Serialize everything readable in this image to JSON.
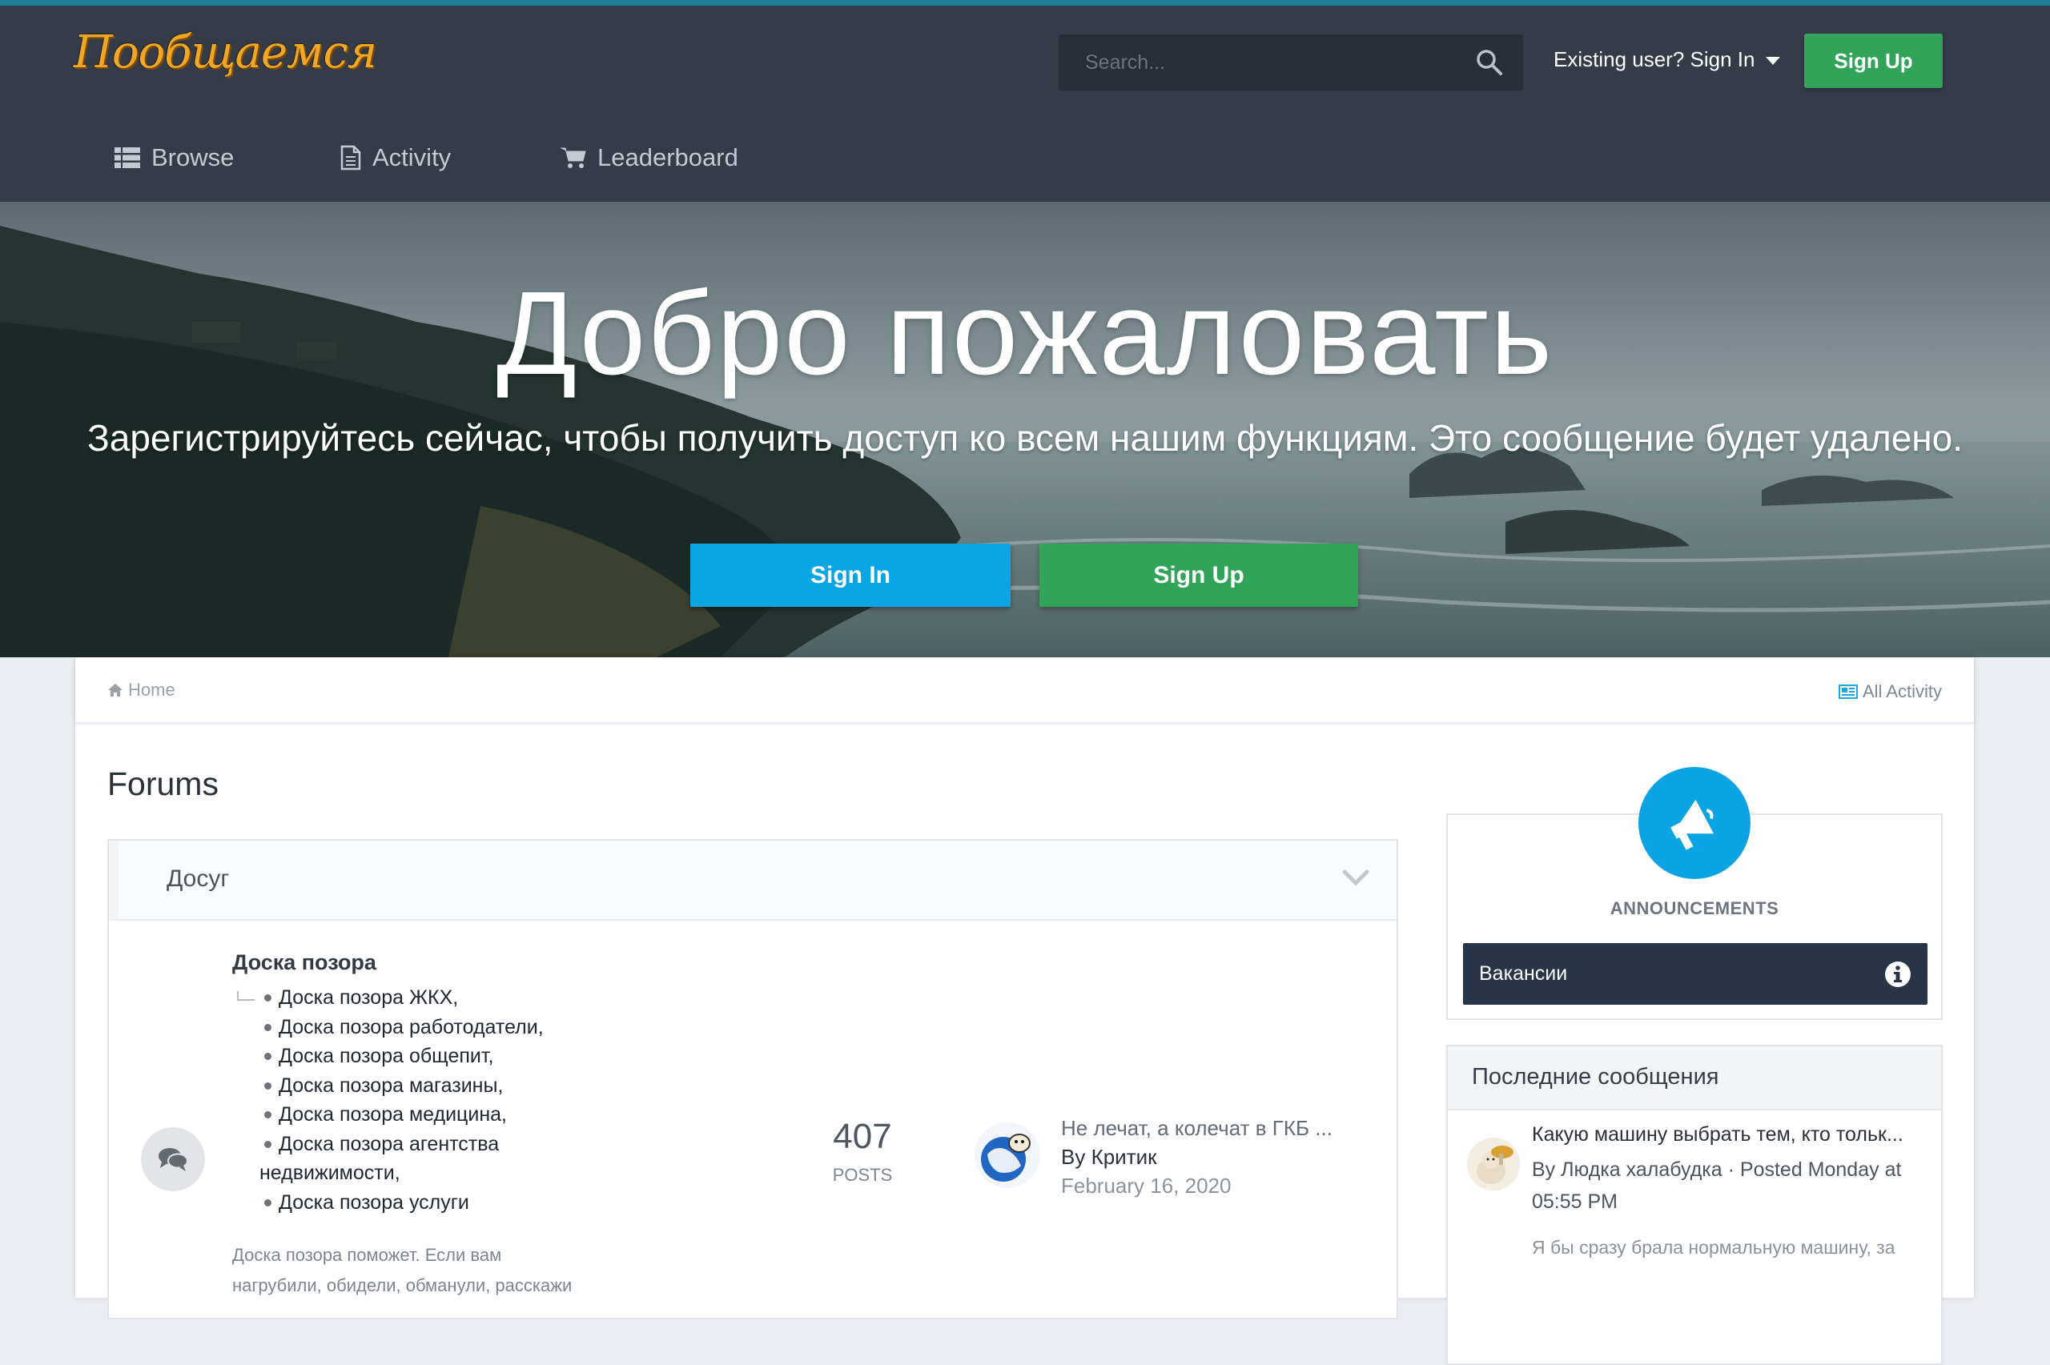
{
  "header": {
    "logo_text": "Пообщаемся",
    "search_placeholder": "Search...",
    "signin_label": "Existing user? Sign In",
    "signup_label": "Sign Up",
    "nav": [
      {
        "label": "Browse",
        "icon": "list-icon"
      },
      {
        "label": "Activity",
        "icon": "document-icon"
      },
      {
        "label": "Leaderboard",
        "icon": "cart-icon"
      }
    ]
  },
  "hero": {
    "title": "Добро пожаловать",
    "subtitle": "Зарегистрируйтесь сейчас, чтобы получить доступ ко всем нашим функциям. Это сообщение будет удалено.",
    "signin_button": "Sign In",
    "signup_button": "Sign Up"
  },
  "breadcrumb": {
    "home": "Home",
    "all_activity": "All Activity"
  },
  "page": {
    "title": "Forums"
  },
  "forums": {
    "category": {
      "title": "Досуг",
      "forum": {
        "name": "Доска позора",
        "subforums": [
          "Доска позора ЖКХ,",
          "Доска позора работодатели,",
          "Доска позора общепит,",
          "Доска позора магазины,",
          "Доска позора медицина,",
          "Доска позора агентства",
          "недвижимости,",
          "Доска позора услуги"
        ],
        "description_line1": "Доска позора поможет. Если вам",
        "description_line2": "нагрубили, обидели, обманули, расскажи",
        "posts_count": "407",
        "posts_label": "POSTS",
        "last_post": {
          "title": "Не лечат, а колечат в ГКБ ...",
          "by": "By Критик",
          "date": "February 16, 2020"
        }
      }
    }
  },
  "sidebar": {
    "announcements": {
      "label": "ANNOUNCEMENTS",
      "items": [
        {
          "title": "Вакансии"
        }
      ]
    },
    "recent": {
      "title": "Последние сообщения",
      "post": {
        "title": "Какую машину выбрать тем, кто тольк...",
        "meta_line1": "By Людка халабудка · Posted Monday at",
        "meta_line2": "05:55 PM",
        "snippet": "Я бы сразу брала нормальную машину, за"
      }
    }
  },
  "colors": {
    "topbar": "#353c48",
    "accent_blue": "#0aa5e5",
    "accent_green": "#32a45a",
    "announcement_bg": "#283447"
  }
}
